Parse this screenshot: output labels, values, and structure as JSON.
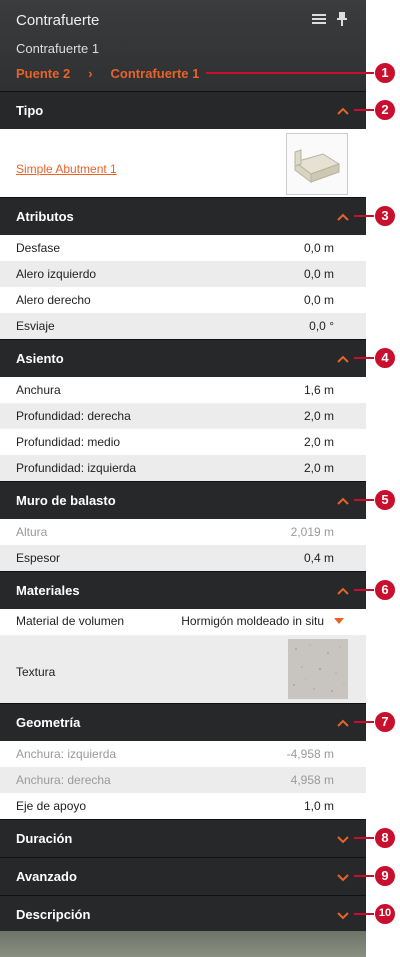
{
  "header": {
    "title": "Contrafuerte",
    "subtitle": "Contrafuerte 1",
    "breadcrumb": [
      "Puente 2",
      "Contrafuerte 1"
    ],
    "breadcrumb_separator": "›",
    "icons": [
      "menu-icon",
      "pin-icon"
    ]
  },
  "sections": {
    "tipo": {
      "title": "Tipo",
      "link": "Simple Abutment 1",
      "expanded": true
    },
    "atributos": {
      "title": "Atributos",
      "rows": [
        {
          "label": "Desfase",
          "value": "0,0 m"
        },
        {
          "label": "Alero izquierdo",
          "value": "0,0 m"
        },
        {
          "label": "Alero derecho",
          "value": "0,0 m"
        },
        {
          "label": "Esviaje",
          "value": "0,0 °"
        }
      ]
    },
    "asiento": {
      "title": "Asiento",
      "rows": [
        {
          "label": "Anchura",
          "value": "1,6 m"
        },
        {
          "label": "Profundidad: derecha",
          "value": "2,0 m"
        },
        {
          "label": "Profundidad: medio",
          "value": "2,0 m"
        },
        {
          "label": "Profundidad: izquierda",
          "value": "2,0 m"
        }
      ]
    },
    "muro": {
      "title": "Muro de balasto",
      "rows": [
        {
          "label": "Altura",
          "value": "2,019 m",
          "disabled": true
        },
        {
          "label": "Espesor",
          "value": "0,4 m"
        }
      ]
    },
    "materiales": {
      "title": "Materiales",
      "material_label": "Material de volumen",
      "material_value": "Hormigón moldeado in situ",
      "texture_label": "Textura"
    },
    "geometria": {
      "title": "Geometría",
      "rows": [
        {
          "label": "Anchura: izquierda",
          "value": "-4,958 m",
          "disabled": true
        },
        {
          "label": "Anchura: derecha",
          "value": "4,958 m",
          "disabled": true
        },
        {
          "label": "Eje de apoyo",
          "value": "1,0 m"
        }
      ]
    },
    "duracion": {
      "title": "Duración",
      "expanded": false
    },
    "avanzado": {
      "title": "Avanzado",
      "expanded": false
    },
    "descripcion": {
      "title": "Descripción",
      "expanded": false
    }
  },
  "callouts": [
    "1",
    "2",
    "3",
    "4",
    "5",
    "6",
    "7",
    "8",
    "9",
    "10"
  ],
  "colors": {
    "accent": "#e8622a",
    "callout": "#c8102e",
    "header_bg": "#262829"
  }
}
